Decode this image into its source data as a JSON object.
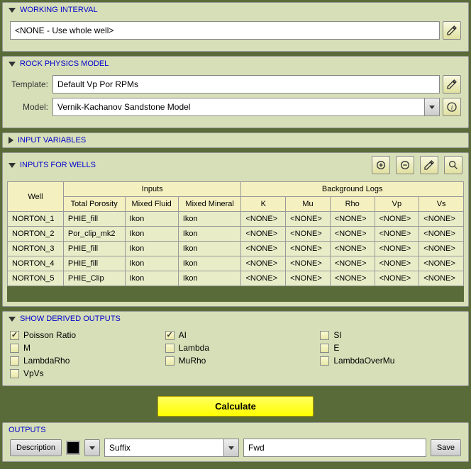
{
  "working_interval": {
    "title": "WORKING INTERVAL",
    "value": "<NONE - Use whole well>"
  },
  "rock_physics": {
    "title": "ROCK PHYSICS MODEL",
    "template_label": "Template:",
    "template_value": "Default Vp Por RPMs",
    "model_label": "Model:",
    "model_value": "Vernik-Kachanov Sandstone Model"
  },
  "input_vars": {
    "title": "INPUT VARIABLES"
  },
  "inputs_wells": {
    "title": "INPUTS FOR WELLS",
    "headers": {
      "well": "Well",
      "inputs": "Inputs",
      "bg": "Background Logs",
      "tp": "Total Porosity",
      "mf": "Mixed Fluid",
      "mm": "Mixed Mineral",
      "k": "K",
      "mu": "Mu",
      "rho": "Rho",
      "vp": "Vp",
      "vs": "Vs"
    },
    "rows": [
      {
        "well": "NORTON_1",
        "tp": "PHIE_fill",
        "mf": "Ikon",
        "mm": "Ikon",
        "k": "<NONE>",
        "mu": "<NONE>",
        "rho": "<NONE>",
        "vp": "<NONE>",
        "vs": "<NONE>"
      },
      {
        "well": "NORTON_2",
        "tp": "Por_clip_mk2",
        "mf": "Ikon",
        "mm": "Ikon",
        "k": "<NONE>",
        "mu": "<NONE>",
        "rho": "<NONE>",
        "vp": "<NONE>",
        "vs": "<NONE>"
      },
      {
        "well": "NORTON_3",
        "tp": "PHIE_fill",
        "mf": "Ikon",
        "mm": "Ikon",
        "k": "<NONE>",
        "mu": "<NONE>",
        "rho": "<NONE>",
        "vp": "<NONE>",
        "vs": "<NONE>"
      },
      {
        "well": "NORTON_4",
        "tp": "PHIE_fill",
        "mf": "Ikon",
        "mm": "Ikon",
        "k": "<NONE>",
        "mu": "<NONE>",
        "rho": "<NONE>",
        "vp": "<NONE>",
        "vs": "<NONE>"
      },
      {
        "well": "NORTON_5",
        "tp": "PHIE_Clip",
        "mf": "Ikon",
        "mm": "Ikon",
        "k": "<NONE>",
        "mu": "<NONE>",
        "rho": "<NONE>",
        "vp": "<NONE>",
        "vs": "<NONE>"
      }
    ]
  },
  "derived": {
    "title": "SHOW DERIVED OUTPUTS",
    "items": [
      {
        "label": "Poisson Ratio",
        "checked": true
      },
      {
        "label": "AI",
        "checked": true
      },
      {
        "label": "SI",
        "checked": false
      },
      {
        "label": "M",
        "checked": false
      },
      {
        "label": "Lambda",
        "checked": false
      },
      {
        "label": "E",
        "checked": false
      },
      {
        "label": "LambdaRho",
        "checked": false
      },
      {
        "label": "MuRho",
        "checked": false
      },
      {
        "label": "LambdaOverMu",
        "checked": false
      },
      {
        "label": "VpVs",
        "checked": false
      }
    ]
  },
  "calculate_label": "Calculate",
  "outputs": {
    "title": "OUTPUTS",
    "description_btn": "Description",
    "suffix_label": "Suffix",
    "suffix_value": "Fwd",
    "save_btn": "Save"
  }
}
